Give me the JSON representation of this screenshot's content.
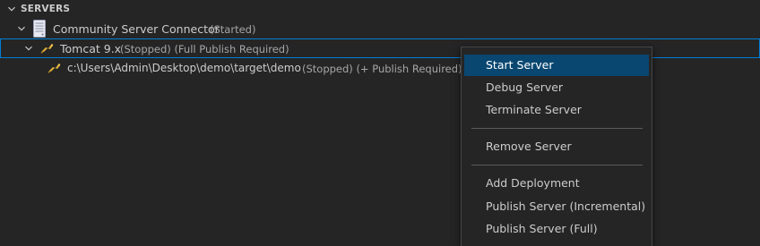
{
  "section": {
    "title": "SERVERS"
  },
  "tree": {
    "connector": {
      "label": "Community Server Connector",
      "status": "(Started)",
      "icon": "server-icon"
    },
    "tomcat": {
      "label": "Tomcat 9.x",
      "status": "(Stopped) (Full Publish Required)",
      "icon": "tomcat-icon"
    },
    "deployment": {
      "label": "c:\\Users\\Admin\\Desktop\\demo\\target\\demo",
      "status": "(Stopped) (+ Publish Required)",
      "icon": "tomcat-icon"
    }
  },
  "context_menu": {
    "groups": [
      [
        "Start Server",
        "Debug Server",
        "Terminate Server"
      ],
      [
        "Remove Server"
      ],
      [
        "Add Deployment",
        "Publish Server (Incremental)",
        "Publish Server (Full)"
      ]
    ],
    "active": "Start Server"
  },
  "colors": {
    "background": "#252526",
    "selection_border": "#007fd4",
    "menu_active": "#094771"
  }
}
